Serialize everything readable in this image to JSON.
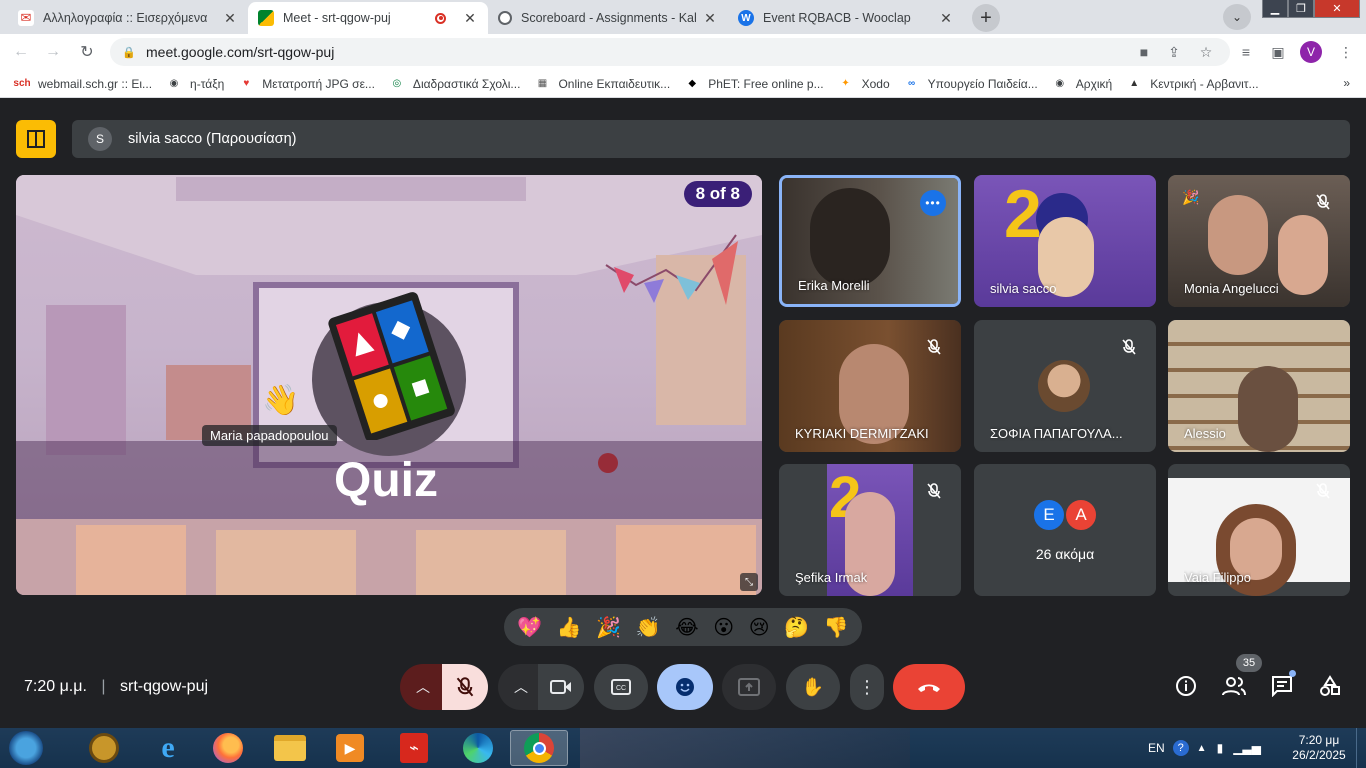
{
  "browser": {
    "tabs": [
      {
        "title": "Αλληλογραφία :: Εισερχόμενα",
        "icon": "mail-icon"
      },
      {
        "title": "Meet - srt-qgow-puj",
        "icon": "meet-icon",
        "recording": true
      },
      {
        "title": "Scoreboard - Assignments - Kahoot",
        "icon": "globe-icon"
      },
      {
        "title": "Event RQBACB - Wooclap",
        "icon": "wooclap-icon"
      }
    ],
    "url": "meet.google.com/srt-qgow-puj",
    "profile_initial": "V",
    "bookmarks": [
      {
        "label": "webmail.sch.gr :: Ει..."
      },
      {
        "label": "η-τάξη"
      },
      {
        "label": "Μετατροπή JPG σε..."
      },
      {
        "label": "Διαδραστικά Σχολι..."
      },
      {
        "label": "Online Εκπαιδευτικ..."
      },
      {
        "label": "PhET: Free online p..."
      },
      {
        "label": "Xodo"
      },
      {
        "label": "Υπουργείο Παιδεία..."
      },
      {
        "label": "Αρχική"
      },
      {
        "label": "Κεντρική - Αρβανιτ..."
      }
    ],
    "bookmarks_more": "»"
  },
  "meet": {
    "presenter_initial": "S",
    "presenter_label": "silvia sacco (Παρουσίαση)",
    "stage": {
      "counter": "8 of 8",
      "title": "Quiz",
      "hand_label": "Maria papadopoulou"
    },
    "tiles": [
      {
        "name": "Erika Morelli"
      },
      {
        "name": "silvia sacco"
      },
      {
        "name": "Monia Angelucci"
      },
      {
        "name": "KYRIAKI DERMITZAKI"
      },
      {
        "name": "ΣΟΦΙΑ ΠΑΠΑΓΟΥΛΑ..."
      },
      {
        "name": "Alessio"
      },
      {
        "name": "Şefika Irmak"
      },
      {
        "name": "26 ακόμα",
        "avatars": [
          "E",
          "A"
        ]
      },
      {
        "name": "Vaia Filippo"
      }
    ],
    "reactions": [
      "💖",
      "👍",
      "🎉",
      "👏",
      "😂",
      "😮",
      "😢",
      "🤔",
      "👎"
    ],
    "clock": "7:20 μ.μ.",
    "meeting_code": "srt-qgow-puj",
    "participant_count": "35",
    "colors": {
      "accent": "#1a73e8",
      "end_call": "#ea4335",
      "mic_off": "#f9dedc",
      "active": "#a8c7fa"
    }
  },
  "taskbar": {
    "lang": "EN",
    "time": "7:20 μμ",
    "date": "26/2/2025"
  }
}
